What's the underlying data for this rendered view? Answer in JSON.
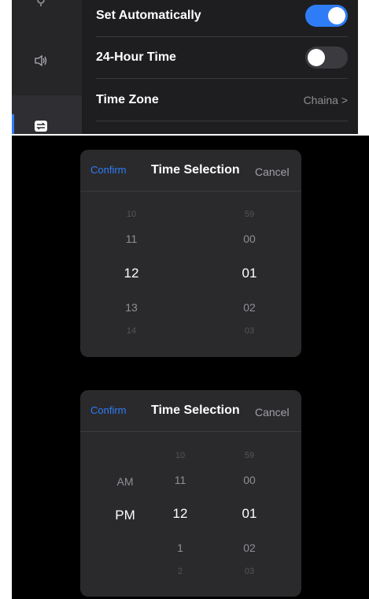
{
  "settings": {
    "rows": [
      {
        "label": "Set Automatically",
        "toggle": "on"
      },
      {
        "label": "24-Hour Time",
        "toggle": "off"
      },
      {
        "label": "Time Zone",
        "value": "Chaina >"
      }
    ]
  },
  "sidebar": {
    "icons": [
      "settings-icon",
      "speaker-icon",
      "transfer-icon"
    ],
    "selected": "transfer-icon"
  },
  "dialog24": {
    "confirm": "Confirm",
    "title": "Time Selection",
    "cancel": "Cancel",
    "hours": [
      "10",
      "11",
      "12",
      "13",
      "14"
    ],
    "minutes": [
      "59",
      "00",
      "01",
      "02",
      "03"
    ],
    "selected_hour": "12",
    "selected_minute": "01"
  },
  "dialog12": {
    "confirm": "Confirm",
    "title": "Time Selection",
    "cancel": "Cancel",
    "periods": [
      "AM",
      "PM"
    ],
    "hours": [
      "10",
      "11",
      "12",
      "1",
      "2"
    ],
    "minutes": [
      "59",
      "00",
      "01",
      "02",
      "03"
    ],
    "selected_period": "PM",
    "selected_hour": "12",
    "selected_minute": "01"
  },
  "colors": {
    "accent": "#2e7df6",
    "panel": "#1e1e20",
    "dialog": "#2a2a2d"
  }
}
